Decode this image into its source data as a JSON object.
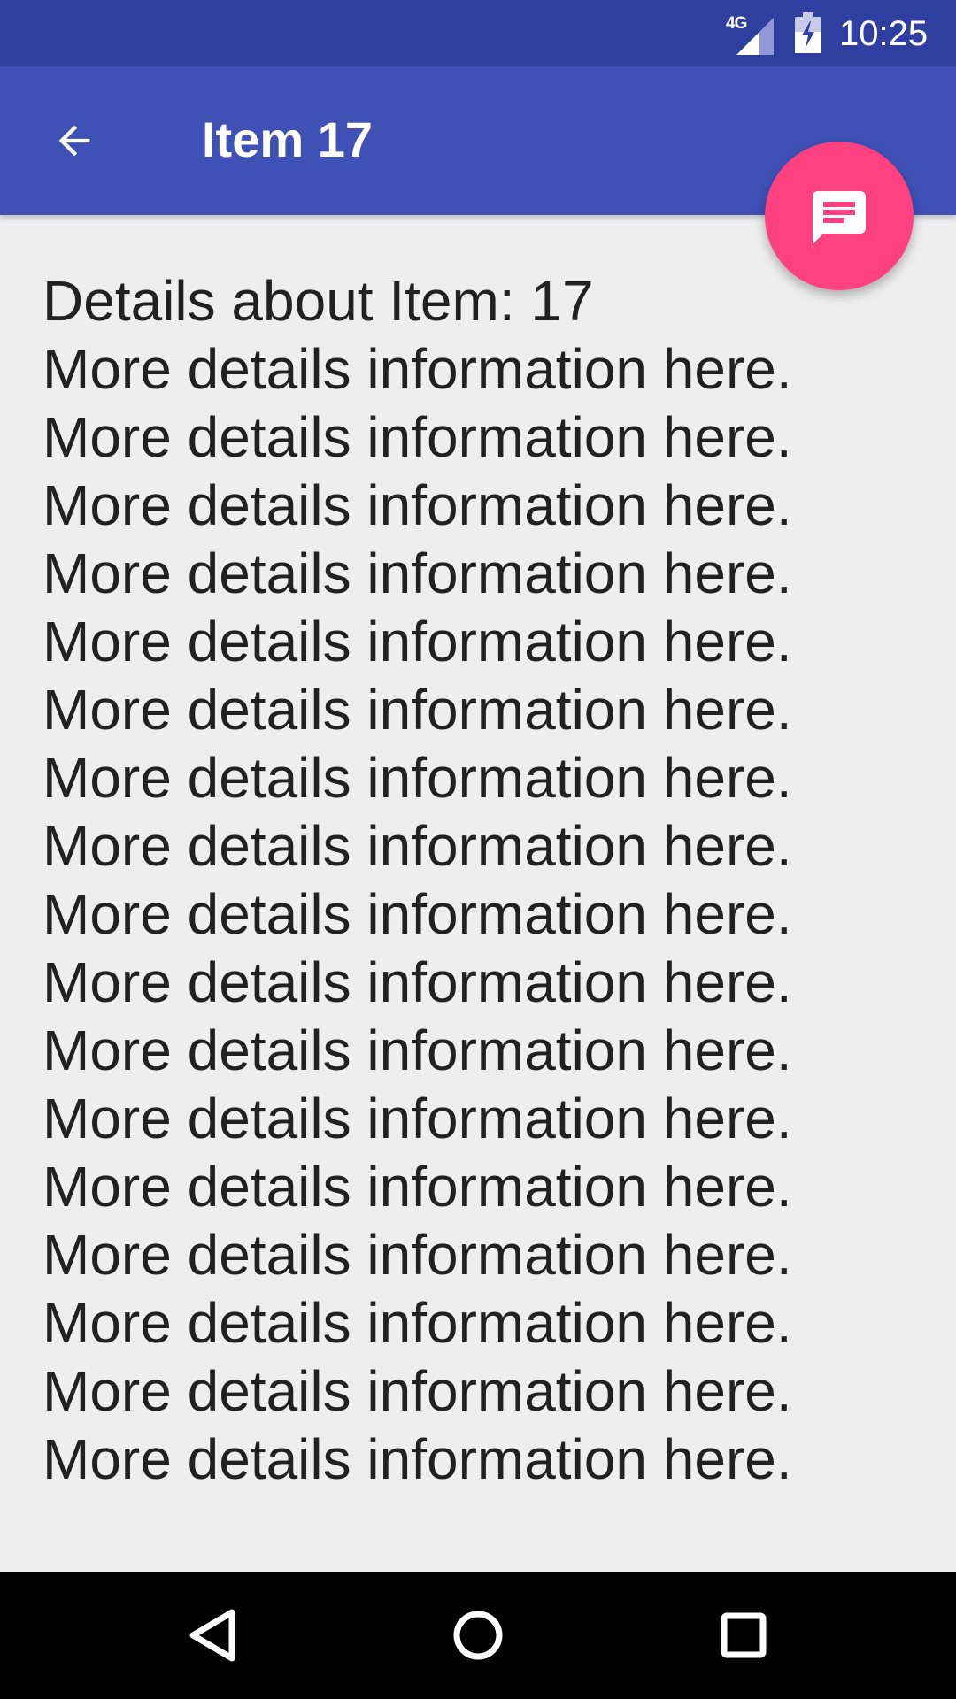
{
  "status_bar": {
    "network_label": "4G",
    "time": "10:25",
    "icons": [
      "signal-icon",
      "battery-charging-icon"
    ]
  },
  "app_bar": {
    "back_icon": "arrow-back-icon",
    "title": "Item 17"
  },
  "fab": {
    "icon": "chat-message-icon"
  },
  "content": {
    "heading": "Details about Item: 17",
    "lines": [
      "More details information here.",
      "More details information here.",
      "More details information here.",
      "More details information here.",
      "More details information here.",
      "More details information here.",
      "More details information here.",
      "More details information here.",
      "More details information here.",
      "More details information here.",
      "More details information here.",
      "More details information here.",
      "More details information here.",
      "More details information here.",
      "More details information here.",
      "More details information here.",
      "More details information here."
    ]
  },
  "nav_bar": {
    "icons": [
      "nav-back-icon",
      "nav-home-icon",
      "nav-recents-icon"
    ]
  },
  "colors": {
    "status_bar": "#303f9f",
    "app_bar": "#3f51b5",
    "accent": "#ff4081",
    "background": "#eeeeee",
    "text": "#212121"
  }
}
